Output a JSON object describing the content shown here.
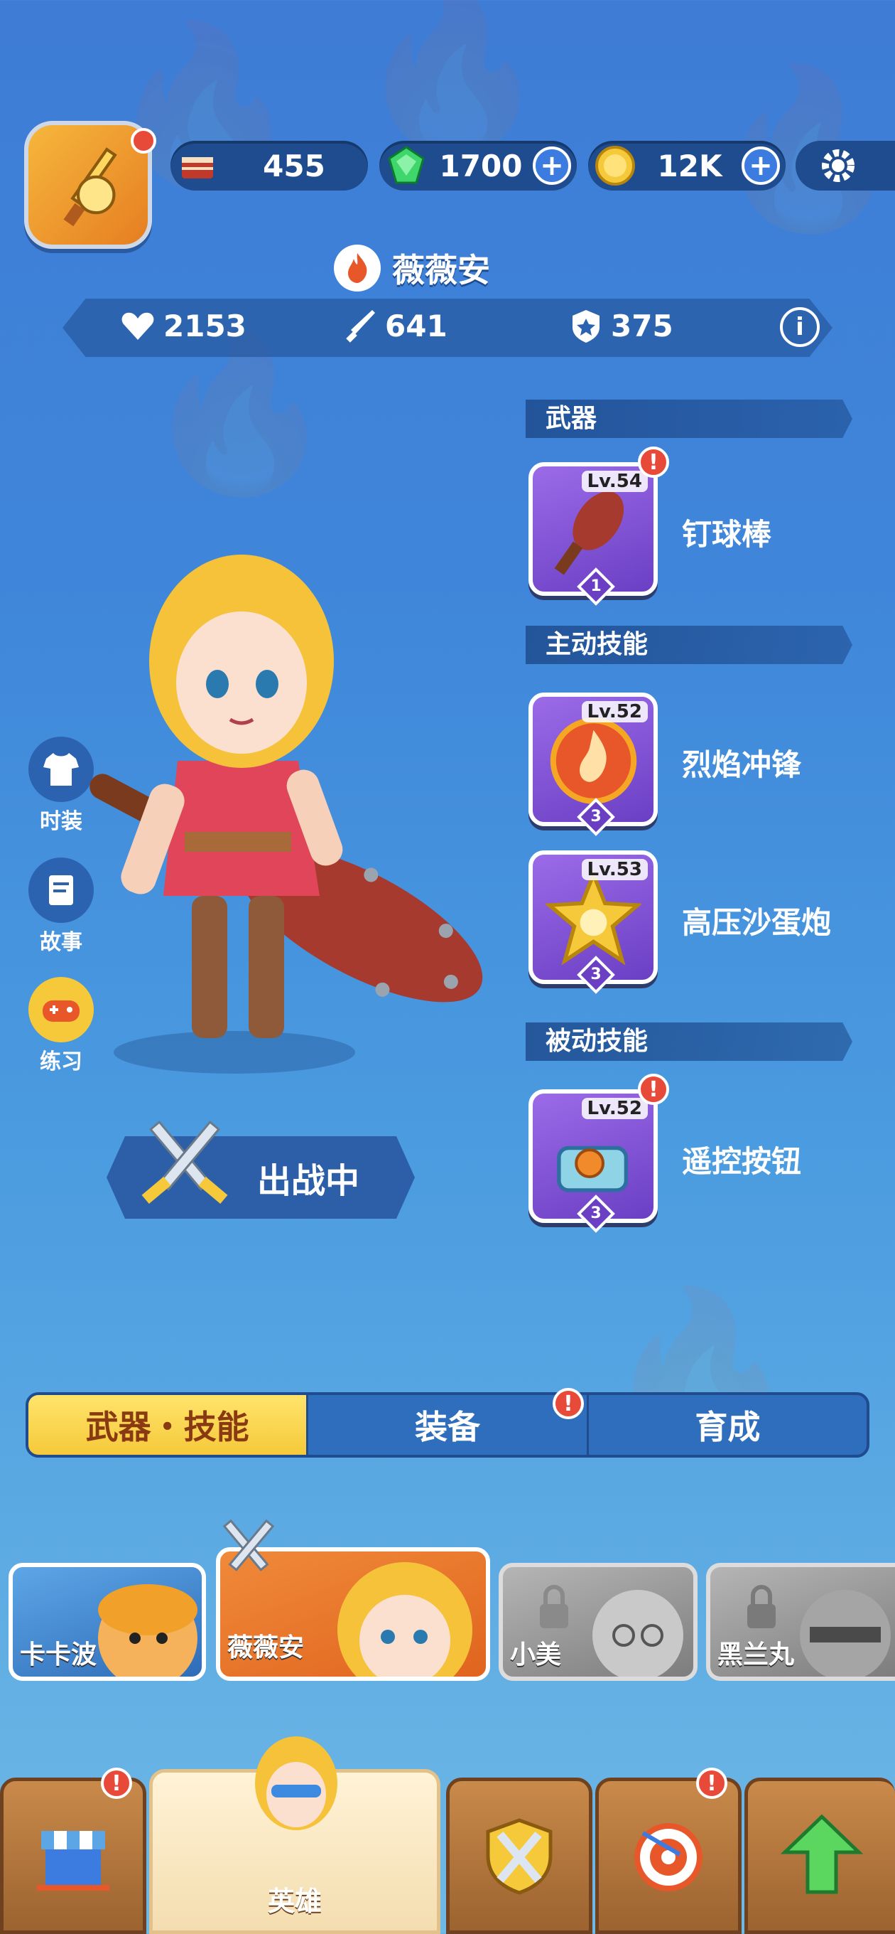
{
  "topbar": {
    "cake": {
      "value": "455",
      "icon": "cake-icon"
    },
    "gems": {
      "value": "1700",
      "icon": "gem-icon"
    },
    "coins": {
      "value": "12K",
      "icon": "coin-icon"
    },
    "settings_icon": "gear-icon"
  },
  "hero": {
    "name": "薇薇安",
    "stats": {
      "hp": "2153",
      "attack": "641",
      "defense": "375"
    },
    "deploy_label": "出战中"
  },
  "side_buttons": [
    {
      "label": "时装",
      "icon": "shirt-icon"
    },
    {
      "label": "故事",
      "icon": "scroll-icon"
    },
    {
      "label": "练习",
      "icon": "gamepad-icon"
    }
  ],
  "sections": {
    "weapon": {
      "title": "武器",
      "items": [
        {
          "name": "钉球棒",
          "level": "Lv.54",
          "stars": "1",
          "alert": "!"
        }
      ]
    },
    "active": {
      "title": "主动技能",
      "items": [
        {
          "name": "烈焰冲锋",
          "level": "Lv.52",
          "stars": "3"
        },
        {
          "name": "高压沙蛋炮",
          "level": "Lv.53",
          "stars": "3"
        }
      ]
    },
    "passive": {
      "title": "被动技能",
      "items": [
        {
          "name": "遥控按钮",
          "level": "Lv.52",
          "stars": "3",
          "alert": "!"
        }
      ]
    }
  },
  "tabs": [
    {
      "label": "武器・技能",
      "active": true
    },
    {
      "label": "装备",
      "alert": "!"
    },
    {
      "label": "育成"
    }
  ],
  "heroes": [
    {
      "name": "卡卡波",
      "locked": false
    },
    {
      "name": "薇薇安",
      "locked": false,
      "selected": true
    },
    {
      "name": "小美",
      "locked": true
    },
    {
      "name": "黑兰丸",
      "locked": true
    }
  ],
  "nav": {
    "shop": {
      "alert": "!"
    },
    "hero": {
      "label": "英雄"
    },
    "battle": {},
    "target": {
      "alert": "!"
    },
    "upgrade": {}
  },
  "colors": {
    "accent": "#F5C93A",
    "panel": "#1E4C8F",
    "card": "#7B4FD6",
    "alert": "#E84A3A"
  }
}
